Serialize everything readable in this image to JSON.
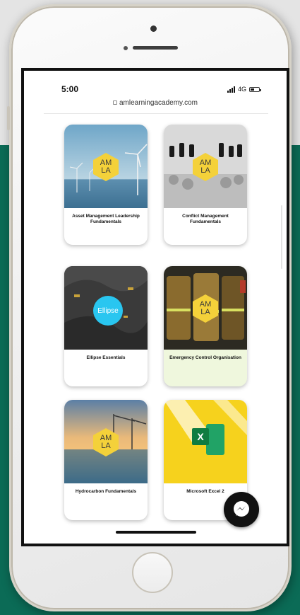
{
  "status_bar": {
    "time": "5:00",
    "network": "4G"
  },
  "browser": {
    "url": "amlearningacademy.com"
  },
  "logo_text": {
    "line1": "AM",
    "line2": "LA"
  },
  "courses": [
    {
      "title": "Asset Management Leadership Fundamentals",
      "image": "wind-turbines"
    },
    {
      "title": "Conflict Management Fundamentals",
      "image": "chess-pieces"
    },
    {
      "title": "Ellipse Essentials",
      "image": "dark-mining-terrain",
      "badge": "Ellipse"
    },
    {
      "title": "Emergency Control Organisation",
      "image": "firefighter-jackets"
    },
    {
      "title": "Hydrocarbon Fundamentals",
      "image": "harbour-sunset"
    },
    {
      "title": "Microsoft Excel 2",
      "image": "excel-logo",
      "badge": "X"
    }
  ],
  "icons": {
    "messenger": "messenger-icon",
    "lock": "lock-icon",
    "signal": "signal-icon",
    "battery": "battery-icon"
  },
  "colors": {
    "background_green": "#0b6b56",
    "amla_yellow": "#f4d13a",
    "ellipse_blue": "#29c6f0",
    "excel_green": "#1f7a45",
    "excel_card_yellow": "#f6d21d"
  }
}
